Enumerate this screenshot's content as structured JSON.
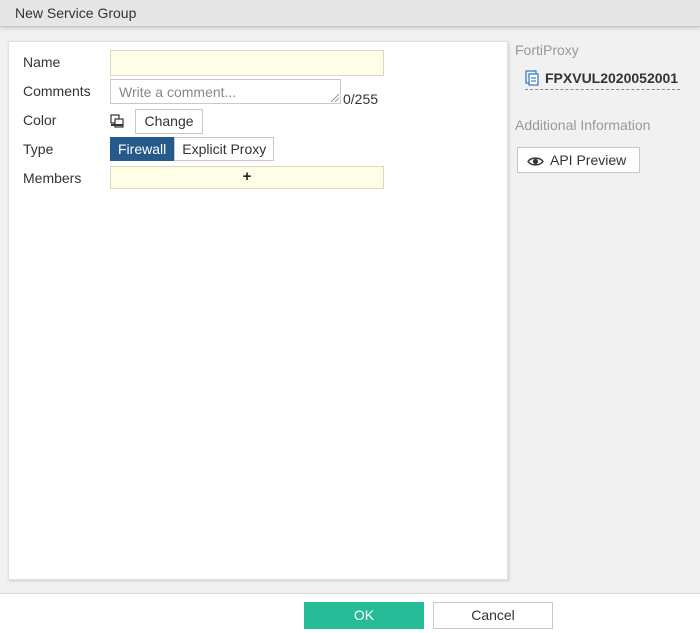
{
  "window": {
    "title": "New Service Group"
  },
  "form": {
    "name_label": "Name",
    "name_value": "",
    "comments_label": "Comments",
    "comments_placeholder": "Write a comment...",
    "comments_counter": "0/255",
    "color_label": "Color",
    "change_button": "Change",
    "type_label": "Type",
    "type_options": [
      "Firewall",
      "Explicit Proxy"
    ],
    "type_selected": "Firewall",
    "members_label": "Members",
    "members_add": "+"
  },
  "sidebar": {
    "product_title": "FortiProxy",
    "device_name": "FPXVUL2020052001",
    "additional_info_title": "Additional Information",
    "api_preview_button": "API Preview"
  },
  "footer": {
    "ok_label": "OK",
    "cancel_label": "Cancel"
  },
  "colors": {
    "accent_selected": "#265a8a",
    "ok_button": "#26bc98",
    "input_bg": "#fefee6"
  }
}
